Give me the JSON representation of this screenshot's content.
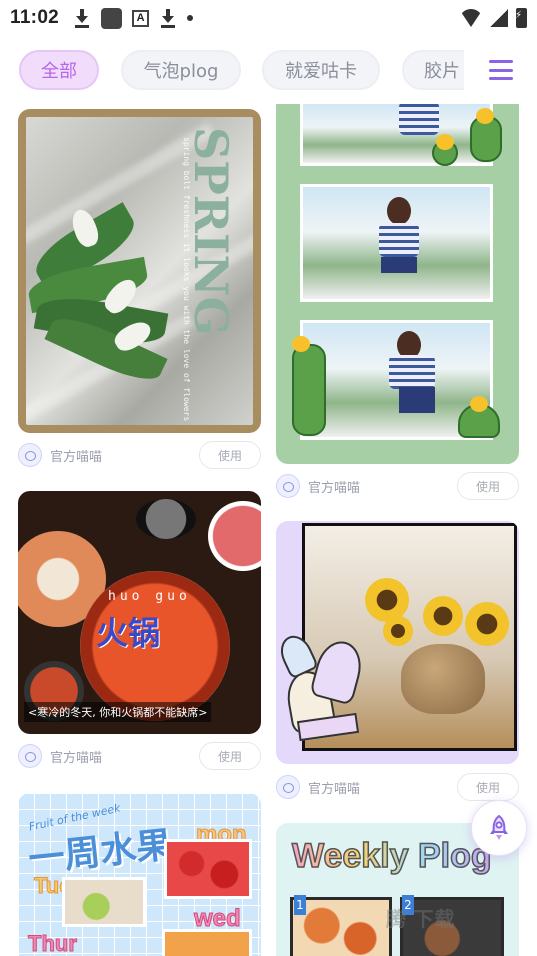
{
  "status_bar": {
    "time": "11:02",
    "a_label": "A"
  },
  "tabs": [
    {
      "label": "全部",
      "active": true
    },
    {
      "label": "气泡plog",
      "active": false
    },
    {
      "label": "就爱咕卡",
      "active": false
    },
    {
      "label": "胶片",
      "active": false
    }
  ],
  "cards": [
    {
      "id": "card-spring",
      "author": "官方喵喵",
      "use_label": "使用",
      "title_text": "SPRING",
      "vert_text": "spring bolt freshness it looks you with the love of flowers"
    },
    {
      "id": "card-cactus",
      "author": "官方喵喵",
      "use_label": "使用"
    },
    {
      "id": "card-hotpot",
      "author": "官方喵喵",
      "use_label": "使用",
      "title_text": "火锅",
      "pinyin": "huo guo",
      "caption": "<寒冷的冬天, 你和火锅都不能缺席>"
    },
    {
      "id": "card-sunflower",
      "author": "官方喵喵",
      "use_label": "使用"
    },
    {
      "id": "card-fruit",
      "title_text": "一周水果",
      "subtitle": "Fruit of the week",
      "days": [
        "mon",
        "Tues",
        "wed",
        "Thur"
      ]
    },
    {
      "id": "card-plog",
      "title_text": "Weekly Plog",
      "numbers": [
        "1",
        "2"
      ]
    }
  ],
  "watermark": "腾 下载",
  "icons": {
    "menu": "menu-icon",
    "rocket": "rocket-icon",
    "avatar": "avatar-icon"
  },
  "colors": {
    "accent": "#b566ea",
    "menu": "#8a63e6"
  }
}
